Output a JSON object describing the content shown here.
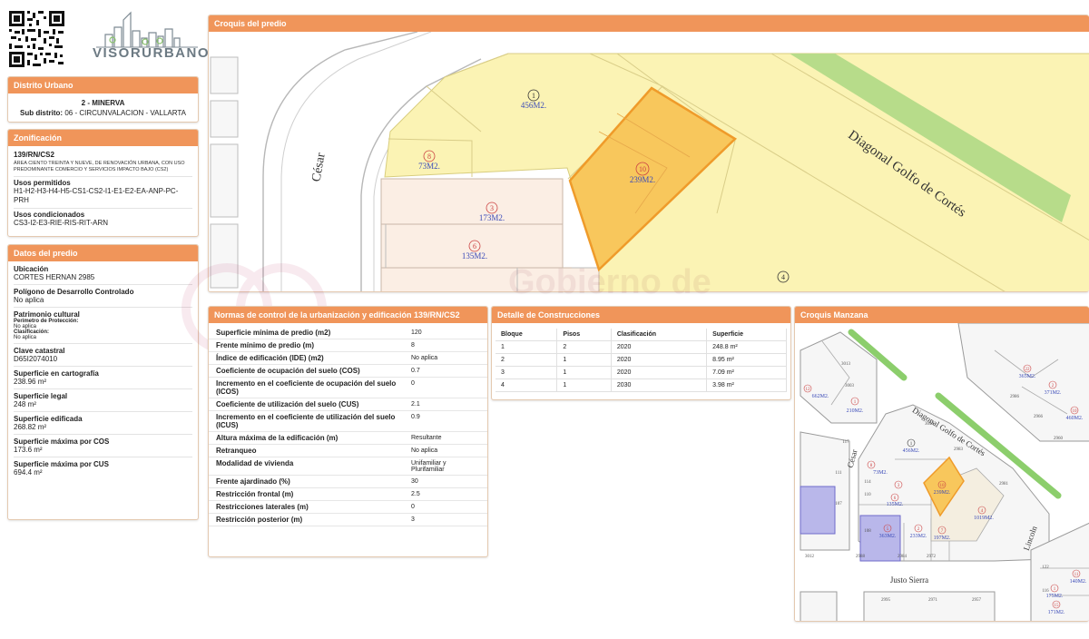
{
  "header": {
    "logo_text": "VISORURBANO"
  },
  "distrito": {
    "title": "Distrito Urbano",
    "name": "2 - MINERVA",
    "sub_label": "Sub distrito:",
    "sub_value": "06 - CIRCUNVALACION - VALLARTA"
  },
  "zonificacion": {
    "title": "Zonificación",
    "code": "139/RN/CS2",
    "description": "ÁREA CIENTO TREINTA Y NUEVE, DE RENOVACIÓN URBANA, CON USO PREDOMINANTE COMERCIO Y SERVICIOS IMPACTO BAJO (CS2)",
    "usos_label": "Usos permitidos",
    "usos_value": "H1-H2-H3-H4-H5-CS1-CS2-I1-E1-E2-EA-ANP-PC-PRH",
    "condicionados_label": "Usos condicionados",
    "condicionados_value": "CS3-I2-E3-RIE-RIS-RIT-ARN"
  },
  "predio": {
    "title": "Datos del predio",
    "ubicacion_label": "Ubicación",
    "ubicacion_value": "CORTES HERNAN 2985",
    "poligono_label": "Polígono de Desarrollo Controlado",
    "poligono_value": "No aplica",
    "patrimonio_label": "Patrimonio cultural",
    "perimetro_label": "Perímetro de Protección:",
    "perimetro_value": "No aplica",
    "clasificacion_label": "Clasificación:",
    "clasificacion_value": "No aplica",
    "clave_label": "Clave catastral",
    "clave_value": "D65I2074010",
    "sup_carto_label": "Superficie en cartografía",
    "sup_carto_value": "238.96 m²",
    "sup_legal_label": "Superficie legal",
    "sup_legal_value": "248 m²",
    "sup_edif_label": "Superficie edificada",
    "sup_edif_value": "268.82 m²",
    "sup_cos_label": "Superficie máxima por COS",
    "sup_cos_value": "173.6 m²",
    "sup_cus_label": "Superficie máxima por CUS",
    "sup_cus_value": "694.4 m²"
  },
  "croquis_predio": {
    "title": "Croquis del predio",
    "street_1": "César",
    "street_2": "Diagonal Golfo de Cortés",
    "lots": [
      {
        "num": "1",
        "area": "456M2."
      },
      {
        "num": "8",
        "area": "73M2."
      },
      {
        "num": "10",
        "area": "239M2."
      },
      {
        "num": "3",
        "area": "173M2."
      },
      {
        "num": "6",
        "area": "135M2."
      },
      {
        "num": "4",
        "area": ""
      }
    ]
  },
  "normas": {
    "title": "Normas de control de la urbanización y edificación 139/RN/CS2",
    "rows": [
      {
        "label": "Superficie mínima de predio (m2)",
        "value": "120"
      },
      {
        "label": "Frente mínimo de predio (m)",
        "value": "8"
      },
      {
        "label": "Índice de edificación (IDE) (m2)",
        "value": "No aplica"
      },
      {
        "label": "Coeficiente de ocupación del suelo (COS)",
        "value": "0.7"
      },
      {
        "label": "Incremento en el coeficiente de ocupación del suelo (ICOS)",
        "value": "0"
      },
      {
        "label": "Coeficiente de utilización del suelo (CUS)",
        "value": "2.1"
      },
      {
        "label": "Incremento en el coeficiente de utilización del suelo (ICUS)",
        "value": "0.9"
      },
      {
        "label": "Altura máxima de la edificación (m)",
        "value": "Resultante"
      },
      {
        "label": "Retranqueo",
        "value": "No aplica"
      },
      {
        "label": "Modalidad de vivienda",
        "value": "Unifamiliar y Plurifamiliar"
      },
      {
        "label": "Frente ajardinado (%)",
        "value": "30"
      },
      {
        "label": "Restricción frontal (m)",
        "value": "2.5"
      },
      {
        "label": "Restricciones laterales (m)",
        "value": "0"
      },
      {
        "label": "Restricción posterior (m)",
        "value": "3"
      }
    ]
  },
  "construcciones": {
    "title": "Detalle de Construcciones",
    "headers": [
      "Bloque",
      "Pisos",
      "Clasificación",
      "Superficie"
    ],
    "rows": [
      [
        "1",
        "2",
        "2020",
        "248.8 m²"
      ],
      [
        "2",
        "1",
        "2020",
        "8.95 m²"
      ],
      [
        "3",
        "1",
        "2020",
        "7.09 m²"
      ],
      [
        "4",
        "1",
        "2030",
        "3.98 m²"
      ]
    ]
  },
  "croquis_manzana": {
    "title": "Croquis Manzana",
    "street_1": "Diagonal Golfo de Cortés",
    "street_2": "César",
    "street_3": "Justo Sierra",
    "street_4": "Lincoln",
    "numbers": [
      "3013",
      "3003",
      "3043",
      "2983",
      "2981",
      "2986",
      "2966",
      "2960",
      "117",
      "111",
      "114",
      "110",
      "107",
      "108",
      "3012",
      "2988",
      "2984",
      "2972",
      "2995",
      "2971",
      "2957",
      "122",
      "116"
    ],
    "lots": [
      {
        "num": "12",
        "area": "662M2."
      },
      {
        "num": "1",
        "area": "210M2."
      },
      {
        "num": "1",
        "area": "456M2."
      },
      {
        "num": "8",
        "area": "73M2."
      },
      {
        "num": "3",
        "area": ""
      },
      {
        "num": "6",
        "area": "135M2."
      },
      {
        "num": "10",
        "area": "239M2."
      },
      {
        "num": "4",
        "area": "1019M2."
      },
      {
        "num": "5",
        "area": "363M2."
      },
      {
        "num": "2",
        "area": "233M2."
      },
      {
        "num": "7",
        "area": "197M2."
      },
      {
        "num": "22",
        "area": "365M2."
      },
      {
        "num": "2",
        "area": "371M2."
      },
      {
        "num": "10",
        "area": "460M2."
      },
      {
        "num": "1",
        "area": "175M2."
      },
      {
        "num": "11",
        "area": "140M2."
      },
      {
        "num": "15",
        "area": "171M2."
      }
    ]
  },
  "watermark": "Gobierno de Guadalajara"
}
